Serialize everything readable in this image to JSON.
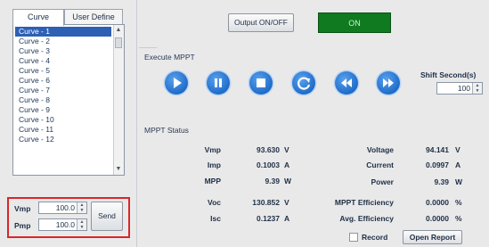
{
  "tabs": [
    "Curve",
    "User Define"
  ],
  "curves": [
    "Curve - 1",
    "Curve - 2",
    "Curve - 3",
    "Curve - 4",
    "Curve - 5",
    "Curve - 6",
    "Curve - 7",
    "Curve - 8",
    "Curve - 9",
    "Curve - 10",
    "Curve - 11",
    "Curve - 12"
  ],
  "selected_curve": "Curve - 1",
  "inputs": {
    "vmp": {
      "label": "Vmp",
      "value": "100.0"
    },
    "pmp": {
      "label": "Pmp",
      "value": "100.0"
    },
    "send_label": "Send"
  },
  "output_button": "Output ON/OFF",
  "output_indicator": "ON",
  "execute_title": "Execute MPPT",
  "shift": {
    "label": "Shift Second(s)",
    "value": "100"
  },
  "controls": [
    "play-icon",
    "pause-icon",
    "stop-icon",
    "refresh-icon",
    "rewind-icon",
    "fast-forward-icon"
  ],
  "status_title": "MPPT Status",
  "status_left": [
    {
      "label": "Vmp",
      "value": "93.630",
      "unit": "V"
    },
    {
      "label": "Imp",
      "value": "0.1003",
      "unit": "A"
    },
    {
      "label": "MPP",
      "value": "9.39",
      "unit": "W"
    },
    {
      "label": "Voc",
      "value": "130.852",
      "unit": "V"
    },
    {
      "label": "Isc",
      "value": "0.1237",
      "unit": "A"
    }
  ],
  "status_right": [
    {
      "label": "Voltage",
      "value": "94.141",
      "unit": "V"
    },
    {
      "label": "Current",
      "value": "0.0997",
      "unit": "A"
    },
    {
      "label": "Power",
      "value": "9.39",
      "unit": "W"
    },
    {
      "label": "MPPT Efficiency",
      "value": "0.0000",
      "unit": "%"
    },
    {
      "label": "Avg. Efficiency",
      "value": "0.0000",
      "unit": "%"
    }
  ],
  "record_label": "Record",
  "open_report_label": "Open Report",
  "colors": {
    "on_green": "#0f7a20",
    "button_blue": "#1f6cc8",
    "highlight_red": "#d9262a",
    "selection": "#2d5fb5"
  }
}
